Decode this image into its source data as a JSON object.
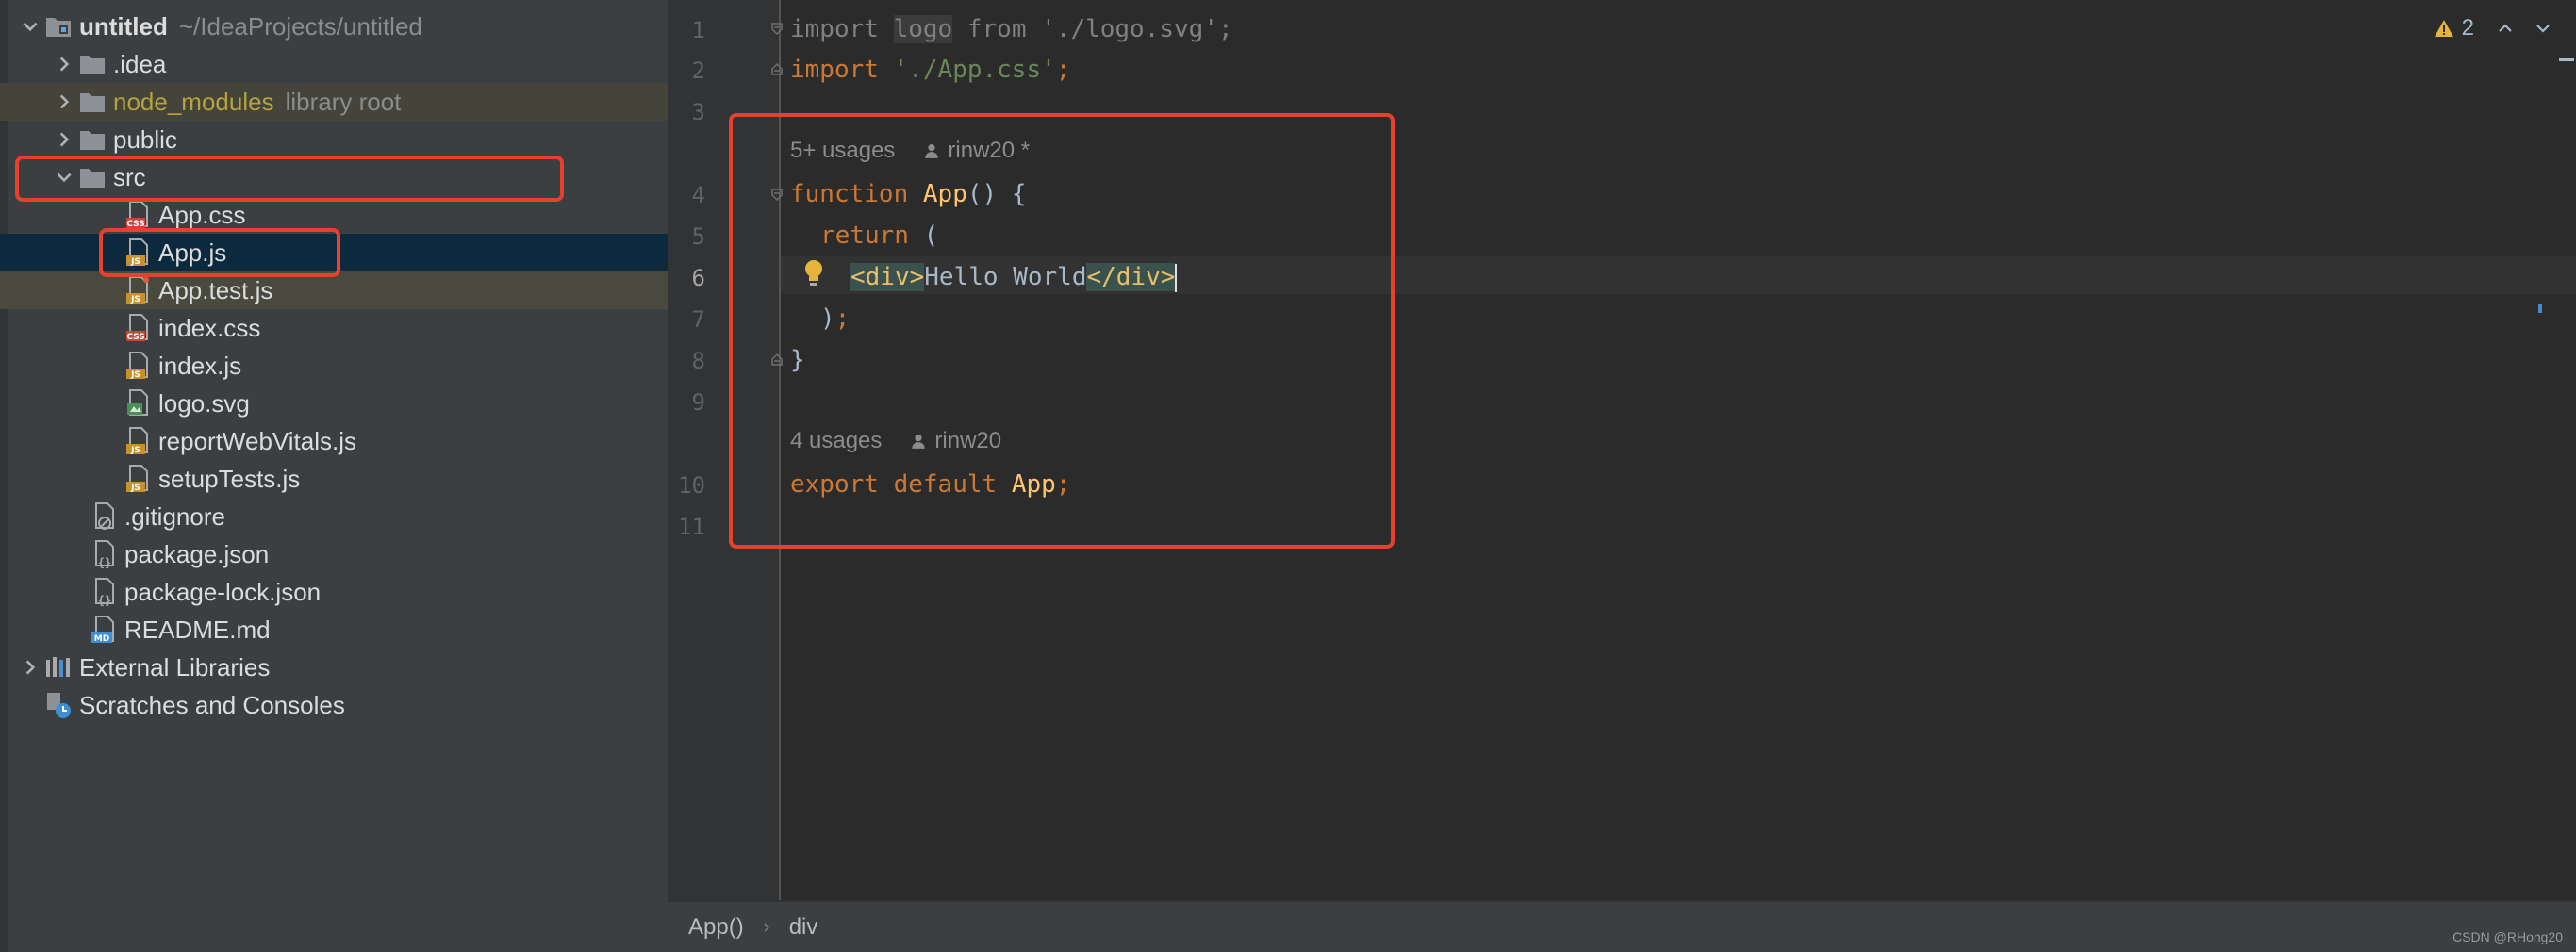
{
  "project_tree": {
    "root": {
      "name": "untitled",
      "path": "~/IdeaProjects/untitled"
    },
    "items": [
      {
        "label": ".idea",
        "type": "folder",
        "state": "collapsed"
      },
      {
        "label": "node_modules",
        "hint": "library root",
        "type": "folder",
        "state": "collapsed"
      },
      {
        "label": "public",
        "type": "folder",
        "state": "collapsed"
      },
      {
        "label": "src",
        "type": "folder",
        "state": "expanded"
      },
      {
        "label": "App.css",
        "type": "css"
      },
      {
        "label": "App.js",
        "type": "js",
        "selected": true
      },
      {
        "label": "App.test.js",
        "type": "js"
      },
      {
        "label": "index.css",
        "type": "css"
      },
      {
        "label": "index.js",
        "type": "js"
      },
      {
        "label": "logo.svg",
        "type": "svg"
      },
      {
        "label": "reportWebVitals.js",
        "type": "js"
      },
      {
        "label": "setupTests.js",
        "type": "js"
      },
      {
        "label": ".gitignore",
        "type": "gitignore"
      },
      {
        "label": "package.json",
        "type": "json"
      },
      {
        "label": "package-lock.json",
        "type": "json"
      },
      {
        "label": "README.md",
        "type": "md"
      },
      {
        "label": "External Libraries",
        "type": "libraries"
      },
      {
        "label": "Scratches and Consoles",
        "type": "scratches"
      }
    ]
  },
  "editor": {
    "line_numbers": [
      "1",
      "2",
      "3",
      "4",
      "5",
      "6",
      "7",
      "8",
      "9",
      "10",
      "11"
    ],
    "current_line": "6",
    "code": {
      "l1": {
        "import": "import",
        "logo": "logo",
        "from": "from",
        "path": "'./logo.svg'",
        "semi": ";"
      },
      "l2": {
        "import": "import",
        "path": "'./App.css'",
        "semi": ";"
      },
      "l4": {
        "kw": "function",
        "name": "App",
        "rest": "() {"
      },
      "l5": {
        "kw": "return",
        "rest": " ("
      },
      "l6": {
        "open": "<div>",
        "text": "Hello World",
        "close": "</div>"
      },
      "l7": {
        "paren": ")",
        "semi": ";"
      },
      "l8": {
        "brace": "}"
      },
      "l10": {
        "kw1": "export",
        "kw2": "default",
        "name": "App",
        "semi": ";"
      }
    },
    "lens1": {
      "usages": "5+ usages",
      "author": "rinw20 *"
    },
    "lens2": {
      "usages": "4 usages",
      "author": "rinw20"
    },
    "warnings": {
      "count": "2"
    },
    "breadcrumb": {
      "items": [
        "App()",
        "div"
      ]
    }
  },
  "watermark": "CSDN @RHong20",
  "colors": {
    "annotation_red": "#e8402d",
    "keyword": "#cc7832",
    "string": "#6a8759",
    "function": "#ffc66d",
    "tag": "#e8bf6a"
  }
}
